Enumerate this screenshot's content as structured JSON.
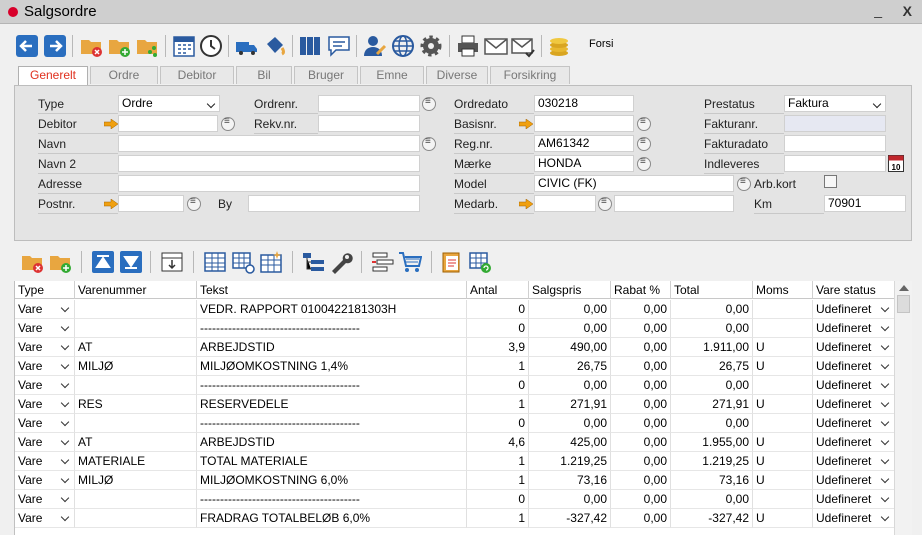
{
  "window": {
    "title": "Salgsordre",
    "minimize": "_",
    "close": "X"
  },
  "toolbar": {
    "forsi_label": "Forsi"
  },
  "tabs": [
    "Generelt",
    "Ordre",
    "Debitor",
    "Bil",
    "Bruger",
    "Emne",
    "Diverse",
    "Forsikring"
  ],
  "form": {
    "type_label": "Type",
    "type_value": "Ordre",
    "debitor_label": "Debitor",
    "debitor_value": "",
    "navn_label": "Navn",
    "navn_value": "",
    "navn2_label": "Navn 2",
    "navn2_value": "",
    "adresse_label": "Adresse",
    "adresse_value": "",
    "postnr_label": "Postnr.",
    "postnr_value": "",
    "by_label": "By",
    "by_value": "",
    "ordrenr_label": "Ordrenr.",
    "ordrenr_value": "",
    "rekvnr_label": "Rekv.nr.",
    "rekvnr_value": "",
    "ordredato_label": "Ordredato",
    "ordredato_value": "030218",
    "basisnr_label": "Basisnr.",
    "basisnr_value": "",
    "regnr_label": "Reg.nr.",
    "regnr_value": "AM61342",
    "maerke_label": "Mærke",
    "maerke_value": "HONDA",
    "model_label": "Model",
    "model_value": "CIVIC (FK)",
    "medarb_label": "Medarb.",
    "medarb_value": "",
    "medarb_name": "",
    "prestatus_label": "Prestatus",
    "prestatus_value": "Faktura",
    "fakturanr_label": "Fakturanr.",
    "fakturanr_value": "",
    "fakturadato_label": "Fakturadato",
    "fakturadato_value": "",
    "indleveres_label": "Indleveres",
    "indleveres_value": "",
    "arbkort_label": "Arb.kort",
    "km_label": "Km",
    "km_value": "70901",
    "calendar_day": "10"
  },
  "grid": {
    "headers": [
      "Type",
      "Varenummer",
      "Tekst",
      "Antal",
      "Salgspris",
      "Rabat %",
      "Total",
      "Moms",
      "Vare status"
    ],
    "rows": [
      [
        "Vare",
        "",
        "VEDR. RAPPORT 0100422181303H",
        "0",
        "0,00",
        "0,00",
        "0,00",
        "",
        "Udefineret"
      ],
      [
        "Vare",
        "",
        "----------------------------------------",
        "0",
        "0,00",
        "0,00",
        "0,00",
        "",
        "Udefineret"
      ],
      [
        "Vare",
        "AT",
        "ARBEJDSTID",
        "3,9",
        "490,00",
        "0,00",
        "1.911,00",
        "U",
        "Udefineret"
      ],
      [
        "Vare",
        "MILJØ",
        "MILJØOMKOSTNING  1,4%",
        "1",
        "26,75",
        "0,00",
        "26,75",
        "U",
        "Udefineret"
      ],
      [
        "Vare",
        "",
        "----------------------------------------",
        "0",
        "0,00",
        "0,00",
        "0,00",
        "",
        "Udefineret"
      ],
      [
        "Vare",
        "RES",
        "RESERVEDELE",
        "1",
        "271,91",
        "0,00",
        "271,91",
        "U",
        "Udefineret"
      ],
      [
        "Vare",
        "",
        "----------------------------------------",
        "0",
        "0,00",
        "0,00",
        "0,00",
        "",
        "Udefineret"
      ],
      [
        "Vare",
        "AT",
        "ARBEJDSTID",
        "4,6",
        "425,00",
        "0,00",
        "1.955,00",
        "U",
        "Udefineret"
      ],
      [
        "Vare",
        "MATERIALE",
        "TOTAL MATERIALE",
        "1",
        "1.219,25",
        "0,00",
        "1.219,25",
        "U",
        "Udefineret"
      ],
      [
        "Vare",
        "MILJØ",
        "MILJØOMKOSTNING  6,0%",
        "1",
        "73,16",
        "0,00",
        "73,16",
        "U",
        "Udefineret"
      ],
      [
        "Vare",
        "",
        "----------------------------------------",
        "0",
        "0,00",
        "0,00",
        "0,00",
        "",
        "Udefineret"
      ],
      [
        "Vare",
        "",
        "FRADRAG TOTALBELØB  6,0%",
        "1",
        "-327,42",
        "0,00",
        "-327,42",
        "U",
        "Udefineret"
      ]
    ]
  },
  "colors": {
    "accent_blue": "#2a6ebf",
    "close_red": "#d8002a",
    "tab_active": "#e0301e",
    "arrow_orange": "#f0a010"
  }
}
